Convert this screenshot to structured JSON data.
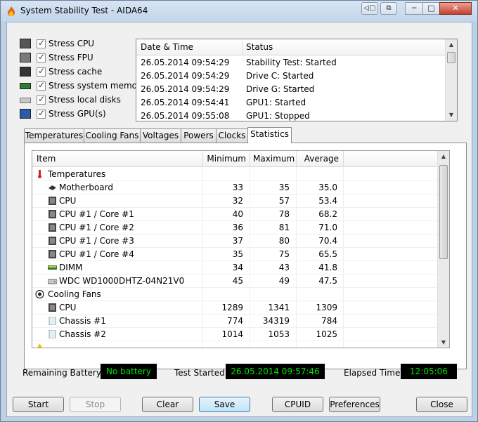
{
  "window": {
    "title": "System Stability Test - AIDA64"
  },
  "titlebar": {
    "min": "─",
    "max": "□",
    "close": "✕"
  },
  "stress": [
    {
      "icon": "cpu-icon",
      "label": "Stress CPU"
    },
    {
      "icon": "fpu-icon",
      "label": "Stress FPU"
    },
    {
      "icon": "cache-icon",
      "label": "Stress cache"
    },
    {
      "icon": "memory-icon",
      "label": "Stress system memory"
    },
    {
      "icon": "disk-icon",
      "label": "Stress local disks"
    },
    {
      "icon": "gpu-icon",
      "label": "Stress GPU(s)"
    }
  ],
  "log": {
    "headers": [
      "Date & Time",
      "Status"
    ],
    "rows": [
      [
        "26.05.2014 09:54:29",
        "Stability Test: Started"
      ],
      [
        "26.05.2014 09:54:29",
        "Drive C: Started"
      ],
      [
        "26.05.2014 09:54:29",
        "Drive G: Started"
      ],
      [
        "26.05.2014 09:54:41",
        "GPU1: Started"
      ],
      [
        "26.05.2014 09:55:08",
        "GPU1: Stopped"
      ]
    ]
  },
  "tabs": [
    "Temperatures",
    "Cooling Fans",
    "Voltages",
    "Powers",
    "Clocks",
    "Statistics"
  ],
  "active_tab": "Statistics",
  "stats": {
    "headers": [
      "Item",
      "Minimum",
      "Maximum",
      "Average"
    ],
    "rows": [
      {
        "name": "Temperatures",
        "group": true,
        "icon": "thermometer-icon",
        "min": "",
        "max": "",
        "avg": ""
      },
      {
        "name": "Motherboard",
        "group": false,
        "icon": "motherboard-icon",
        "min": "33",
        "max": "35",
        "avg": "35.0"
      },
      {
        "name": "CPU",
        "group": false,
        "icon": "cpu-icon",
        "min": "32",
        "max": "57",
        "avg": "53.4"
      },
      {
        "name": "CPU #1 / Core #1",
        "group": false,
        "icon": "cpu-icon",
        "min": "40",
        "max": "78",
        "avg": "68.2"
      },
      {
        "name": "CPU #1 / Core #2",
        "group": false,
        "icon": "cpu-icon",
        "min": "36",
        "max": "81",
        "avg": "71.0"
      },
      {
        "name": "CPU #1 / Core #3",
        "group": false,
        "icon": "cpu-icon",
        "min": "37",
        "max": "80",
        "avg": "70.4"
      },
      {
        "name": "CPU #1 / Core #4",
        "group": false,
        "icon": "cpu-icon",
        "min": "35",
        "max": "75",
        "avg": "65.5"
      },
      {
        "name": "DIMM",
        "group": false,
        "icon": "memory-icon",
        "min": "34",
        "max": "43",
        "avg": "41.8"
      },
      {
        "name": "WDC WD1000DHTZ-04N21V0",
        "group": false,
        "icon": "disk-icon",
        "min": "45",
        "max": "49",
        "avg": "47.5"
      },
      {
        "name": "Cooling Fans",
        "group": true,
        "icon": "fan-icon",
        "min": "",
        "max": "",
        "avg": ""
      },
      {
        "name": "CPU",
        "group": false,
        "icon": "cpu-icon",
        "min": "1289",
        "max": "1341",
        "avg": "1309"
      },
      {
        "name": "Chassis #1",
        "group": false,
        "icon": "chassis-icon",
        "min": "774",
        "max": "34319",
        "avg": "784"
      },
      {
        "name": "Chassis #2",
        "group": false,
        "icon": "chassis-icon",
        "min": "1014",
        "max": "1053",
        "avg": "1025"
      }
    ]
  },
  "info": {
    "battery_label": "Remaining Battery:",
    "battery_value": "No battery",
    "started_label": "Test Started:",
    "started_value": "26.05.2014 09:57:46",
    "elapsed_label": "Elapsed Time:",
    "elapsed_value": "12:05:06"
  },
  "buttons": {
    "start": "Start",
    "stop": "Stop",
    "clear": "Clear",
    "save": "Save",
    "cpuid": "CPUID",
    "preferences": "Preferences",
    "close": "Close"
  }
}
